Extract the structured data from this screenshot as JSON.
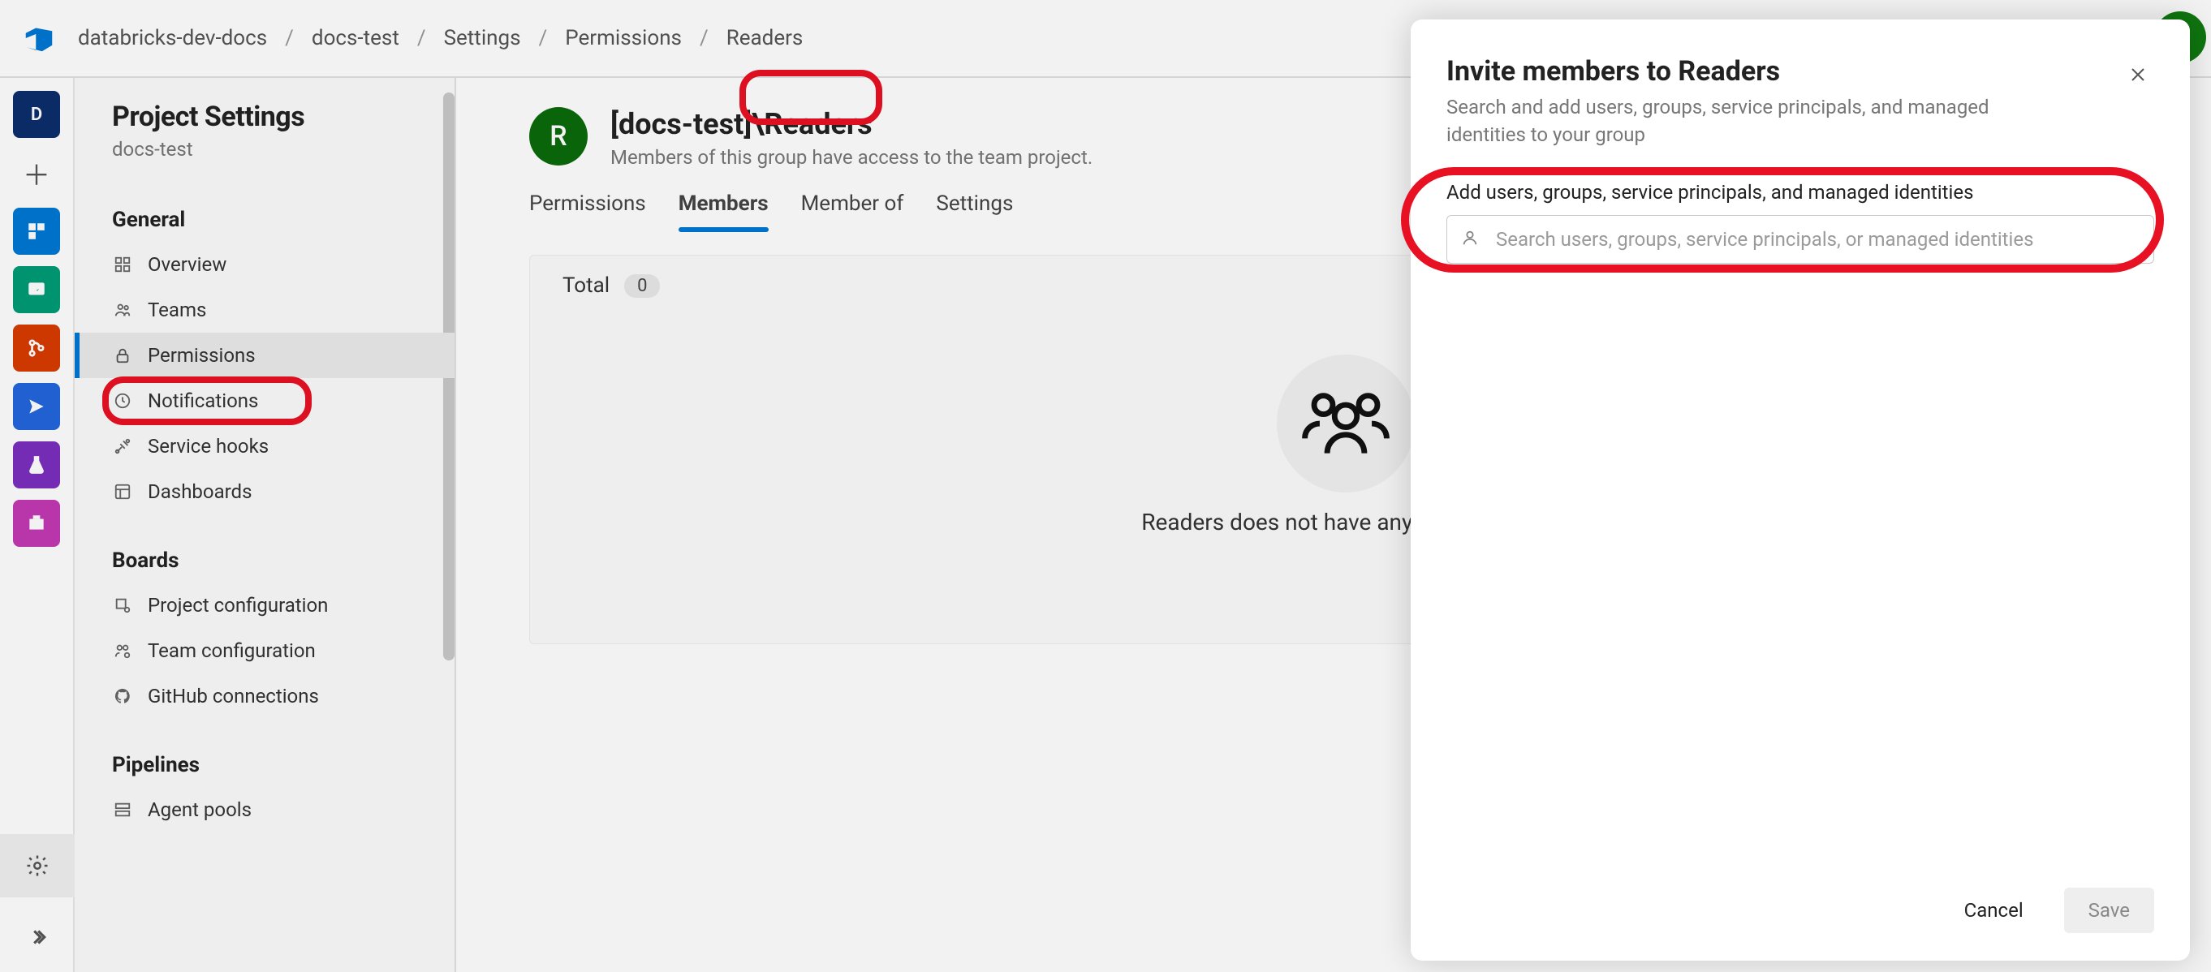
{
  "breadcrumb": [
    "databricks-dev-docs",
    "docs-test",
    "Settings",
    "Permissions",
    "Readers"
  ],
  "rail": {
    "items": [
      {
        "label": "D",
        "bg": "#0b2e6b"
      },
      {
        "label": "plus"
      },
      {
        "label": "",
        "bg": "#0078d4",
        "icon": "board"
      },
      {
        "label": "",
        "bg": "#009b77",
        "icon": "work"
      },
      {
        "label": "",
        "bg": "#d83b01",
        "icon": "repo"
      },
      {
        "label": "",
        "bg": "#2266dd",
        "icon": "pipeline"
      },
      {
        "label": "",
        "bg": "#7b2fbf",
        "icon": "test"
      },
      {
        "label": "",
        "bg": "#c239b3",
        "icon": "artifact"
      }
    ]
  },
  "sidebar": {
    "title": "Project Settings",
    "subtitle": "docs-test",
    "sections": [
      {
        "head": "General",
        "items": [
          {
            "label": "Overview",
            "icon": "grid"
          },
          {
            "label": "Teams",
            "icon": "people"
          },
          {
            "label": "Permissions",
            "icon": "lock",
            "active": true
          },
          {
            "label": "Notifications",
            "icon": "bell"
          },
          {
            "label": "Service hooks",
            "icon": "hook"
          },
          {
            "label": "Dashboards",
            "icon": "dash"
          }
        ]
      },
      {
        "head": "Boards",
        "items": [
          {
            "label": "Project configuration",
            "icon": "proj"
          },
          {
            "label": "Team configuration",
            "icon": "team"
          },
          {
            "label": "GitHub connections",
            "icon": "github"
          }
        ]
      },
      {
        "head": "Pipelines",
        "items": [
          {
            "label": "Agent pools",
            "icon": "pool"
          }
        ]
      }
    ]
  },
  "group": {
    "initial": "R",
    "title": "[docs-test]\\Readers",
    "subtitle": "Members of this group have access to the team project."
  },
  "tabs": [
    "Permissions",
    "Members",
    "Member of",
    "Settings"
  ],
  "activeTab": "Members",
  "members": {
    "total_label": "Total",
    "total_count": "0",
    "empty_text": "Readers does not have any members yet"
  },
  "modal": {
    "title": "Invite members to Readers",
    "subtitle": "Search and add users, groups, service principals, and managed identities to your group",
    "field_label": "Add users, groups, service principals, and managed identities",
    "placeholder": "Search users, groups, service principals, or managed identities",
    "cancel": "Cancel",
    "save": "Save"
  }
}
